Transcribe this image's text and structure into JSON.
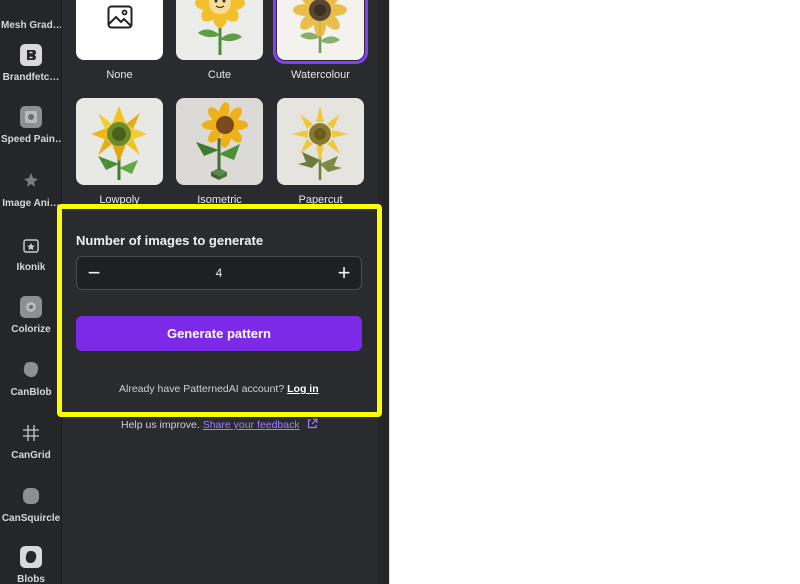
{
  "sidebar": {
    "items": [
      {
        "label": "Mesh Grad…",
        "icon": "mesh-gradient-icon"
      },
      {
        "label": "Brandfetc…",
        "icon": "brandfetch-icon"
      },
      {
        "label": "Speed Pain…",
        "icon": "speed-paint-icon"
      },
      {
        "label": "Image Ani…",
        "icon": "image-animation-icon"
      },
      {
        "label": "Ikonik",
        "icon": "ikonik-icon"
      },
      {
        "label": "Colorize",
        "icon": "colorize-icon"
      },
      {
        "label": "CanBlob",
        "icon": "blob-icon"
      },
      {
        "label": "CanGrid",
        "icon": "grid-icon"
      },
      {
        "label": "CanSquircle",
        "icon": "squircle-icon"
      },
      {
        "label": "Blobs",
        "icon": "blobs-icon"
      }
    ]
  },
  "styles": [
    {
      "label": "None",
      "selected": false
    },
    {
      "label": "Cute",
      "selected": false
    },
    {
      "label": "Watercolour",
      "selected": true
    },
    {
      "label": "Lowpoly",
      "selected": false
    },
    {
      "label": "Isometric",
      "selected": false
    },
    {
      "label": "Papercut",
      "selected": false
    }
  ],
  "generate": {
    "count_label": "Number of images to generate",
    "count_value": "4",
    "decrement": "−",
    "increment": "+",
    "button_label": "Generate pattern"
  },
  "account": {
    "prompt": "Already have PatternedAI account?",
    "login_label": "Log in"
  },
  "feedback": {
    "prompt": "Help us improve.",
    "link_label": "Share your feedback"
  },
  "colors": {
    "accent": "#7d2ae8",
    "selection": "#8b3dff",
    "highlight": "#fdfd00"
  }
}
